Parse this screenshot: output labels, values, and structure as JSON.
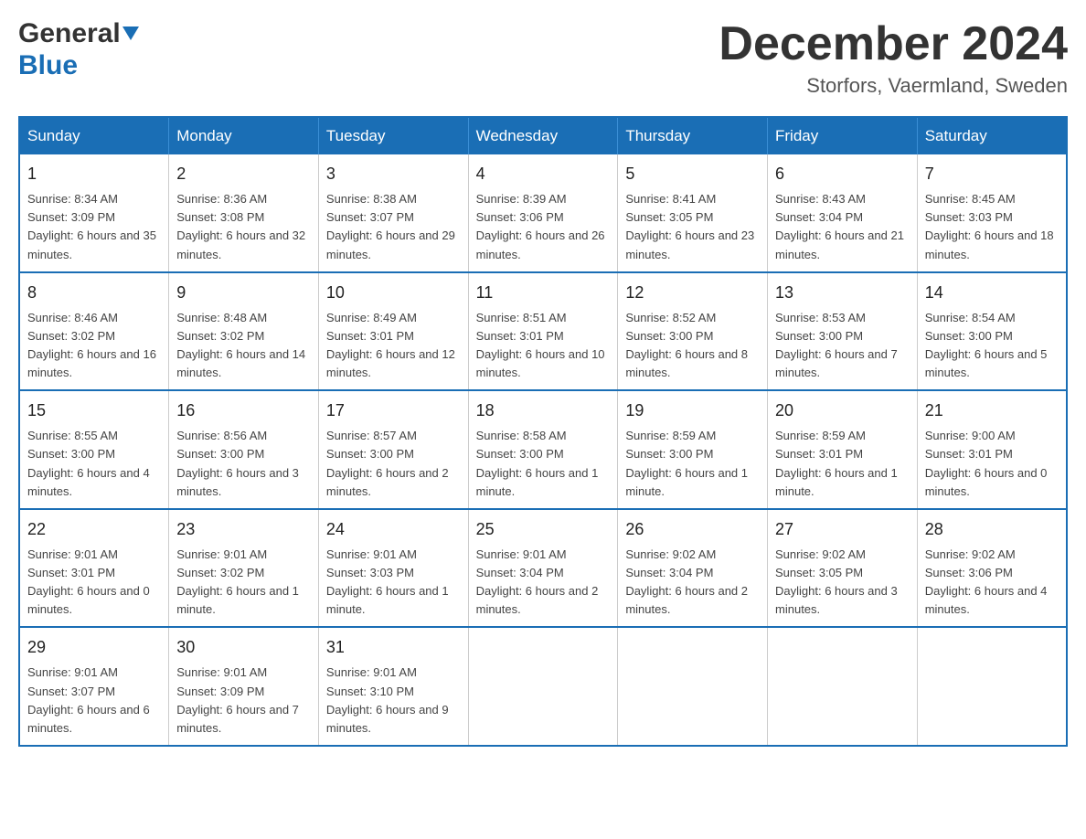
{
  "header": {
    "logo_general": "General",
    "logo_blue": "Blue",
    "month_title": "December 2024",
    "location": "Storfors, Vaermland, Sweden"
  },
  "days_of_week": [
    "Sunday",
    "Monday",
    "Tuesday",
    "Wednesday",
    "Thursday",
    "Friday",
    "Saturday"
  ],
  "weeks": [
    [
      {
        "day": "1",
        "sunrise": "Sunrise: 8:34 AM",
        "sunset": "Sunset: 3:09 PM",
        "daylight": "Daylight: 6 hours and 35 minutes."
      },
      {
        "day": "2",
        "sunrise": "Sunrise: 8:36 AM",
        "sunset": "Sunset: 3:08 PM",
        "daylight": "Daylight: 6 hours and 32 minutes."
      },
      {
        "day": "3",
        "sunrise": "Sunrise: 8:38 AM",
        "sunset": "Sunset: 3:07 PM",
        "daylight": "Daylight: 6 hours and 29 minutes."
      },
      {
        "day": "4",
        "sunrise": "Sunrise: 8:39 AM",
        "sunset": "Sunset: 3:06 PM",
        "daylight": "Daylight: 6 hours and 26 minutes."
      },
      {
        "day": "5",
        "sunrise": "Sunrise: 8:41 AM",
        "sunset": "Sunset: 3:05 PM",
        "daylight": "Daylight: 6 hours and 23 minutes."
      },
      {
        "day": "6",
        "sunrise": "Sunrise: 8:43 AM",
        "sunset": "Sunset: 3:04 PM",
        "daylight": "Daylight: 6 hours and 21 minutes."
      },
      {
        "day": "7",
        "sunrise": "Sunrise: 8:45 AM",
        "sunset": "Sunset: 3:03 PM",
        "daylight": "Daylight: 6 hours and 18 minutes."
      }
    ],
    [
      {
        "day": "8",
        "sunrise": "Sunrise: 8:46 AM",
        "sunset": "Sunset: 3:02 PM",
        "daylight": "Daylight: 6 hours and 16 minutes."
      },
      {
        "day": "9",
        "sunrise": "Sunrise: 8:48 AM",
        "sunset": "Sunset: 3:02 PM",
        "daylight": "Daylight: 6 hours and 14 minutes."
      },
      {
        "day": "10",
        "sunrise": "Sunrise: 8:49 AM",
        "sunset": "Sunset: 3:01 PM",
        "daylight": "Daylight: 6 hours and 12 minutes."
      },
      {
        "day": "11",
        "sunrise": "Sunrise: 8:51 AM",
        "sunset": "Sunset: 3:01 PM",
        "daylight": "Daylight: 6 hours and 10 minutes."
      },
      {
        "day": "12",
        "sunrise": "Sunrise: 8:52 AM",
        "sunset": "Sunset: 3:00 PM",
        "daylight": "Daylight: 6 hours and 8 minutes."
      },
      {
        "day": "13",
        "sunrise": "Sunrise: 8:53 AM",
        "sunset": "Sunset: 3:00 PM",
        "daylight": "Daylight: 6 hours and 7 minutes."
      },
      {
        "day": "14",
        "sunrise": "Sunrise: 8:54 AM",
        "sunset": "Sunset: 3:00 PM",
        "daylight": "Daylight: 6 hours and 5 minutes."
      }
    ],
    [
      {
        "day": "15",
        "sunrise": "Sunrise: 8:55 AM",
        "sunset": "Sunset: 3:00 PM",
        "daylight": "Daylight: 6 hours and 4 minutes."
      },
      {
        "day": "16",
        "sunrise": "Sunrise: 8:56 AM",
        "sunset": "Sunset: 3:00 PM",
        "daylight": "Daylight: 6 hours and 3 minutes."
      },
      {
        "day": "17",
        "sunrise": "Sunrise: 8:57 AM",
        "sunset": "Sunset: 3:00 PM",
        "daylight": "Daylight: 6 hours and 2 minutes."
      },
      {
        "day": "18",
        "sunrise": "Sunrise: 8:58 AM",
        "sunset": "Sunset: 3:00 PM",
        "daylight": "Daylight: 6 hours and 1 minute."
      },
      {
        "day": "19",
        "sunrise": "Sunrise: 8:59 AM",
        "sunset": "Sunset: 3:00 PM",
        "daylight": "Daylight: 6 hours and 1 minute."
      },
      {
        "day": "20",
        "sunrise": "Sunrise: 8:59 AM",
        "sunset": "Sunset: 3:01 PM",
        "daylight": "Daylight: 6 hours and 1 minute."
      },
      {
        "day": "21",
        "sunrise": "Sunrise: 9:00 AM",
        "sunset": "Sunset: 3:01 PM",
        "daylight": "Daylight: 6 hours and 0 minutes."
      }
    ],
    [
      {
        "day": "22",
        "sunrise": "Sunrise: 9:01 AM",
        "sunset": "Sunset: 3:01 PM",
        "daylight": "Daylight: 6 hours and 0 minutes."
      },
      {
        "day": "23",
        "sunrise": "Sunrise: 9:01 AM",
        "sunset": "Sunset: 3:02 PM",
        "daylight": "Daylight: 6 hours and 1 minute."
      },
      {
        "day": "24",
        "sunrise": "Sunrise: 9:01 AM",
        "sunset": "Sunset: 3:03 PM",
        "daylight": "Daylight: 6 hours and 1 minute."
      },
      {
        "day": "25",
        "sunrise": "Sunrise: 9:01 AM",
        "sunset": "Sunset: 3:04 PM",
        "daylight": "Daylight: 6 hours and 2 minutes."
      },
      {
        "day": "26",
        "sunrise": "Sunrise: 9:02 AM",
        "sunset": "Sunset: 3:04 PM",
        "daylight": "Daylight: 6 hours and 2 minutes."
      },
      {
        "day": "27",
        "sunrise": "Sunrise: 9:02 AM",
        "sunset": "Sunset: 3:05 PM",
        "daylight": "Daylight: 6 hours and 3 minutes."
      },
      {
        "day": "28",
        "sunrise": "Sunrise: 9:02 AM",
        "sunset": "Sunset: 3:06 PM",
        "daylight": "Daylight: 6 hours and 4 minutes."
      }
    ],
    [
      {
        "day": "29",
        "sunrise": "Sunrise: 9:01 AM",
        "sunset": "Sunset: 3:07 PM",
        "daylight": "Daylight: 6 hours and 6 minutes."
      },
      {
        "day": "30",
        "sunrise": "Sunrise: 9:01 AM",
        "sunset": "Sunset: 3:09 PM",
        "daylight": "Daylight: 6 hours and 7 minutes."
      },
      {
        "day": "31",
        "sunrise": "Sunrise: 9:01 AM",
        "sunset": "Sunset: 3:10 PM",
        "daylight": "Daylight: 6 hours and 9 minutes."
      },
      null,
      null,
      null,
      null
    ]
  ]
}
